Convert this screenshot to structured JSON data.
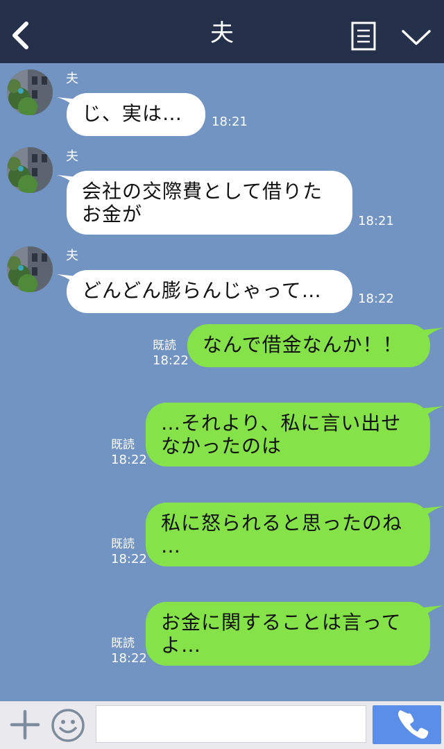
{
  "header": {
    "title": "夫"
  },
  "messages": [
    {
      "sender": "夫",
      "text": "じ、実は…",
      "time": "18:21"
    },
    {
      "sender": "夫",
      "text": "会社の交際費として借りた\nお金が",
      "time": "18:21"
    },
    {
      "sender": "夫",
      "text": "どんどん膨らんじゃって…",
      "time": "18:22"
    },
    {
      "read": "既読",
      "text": "なんで借金なんか！！",
      "time": "18:22"
    },
    {
      "read": "既読",
      "text": "…それより、私に言い出せ\nなかったのは",
      "time": "18:22"
    },
    {
      "read": "既読",
      "text": "私に怒られると思ったのね\n…",
      "time": "18:22"
    },
    {
      "read": "既読",
      "text": "お金に関することは言って\nよ…",
      "time": "18:22"
    }
  ],
  "input": {
    "value": "",
    "placeholder": ""
  },
  "colors": {
    "header_bg": "#25314a",
    "chat_bg": "#7194c3",
    "incoming_bubble": "#ffffff",
    "outgoing_bubble": "#85e249",
    "call_button": "#5b8ee8"
  },
  "icons": [
    "back-chevron-icon",
    "menu-list-icon",
    "chevron-down-icon",
    "plus-icon",
    "emoji-icon",
    "phone-icon"
  ]
}
